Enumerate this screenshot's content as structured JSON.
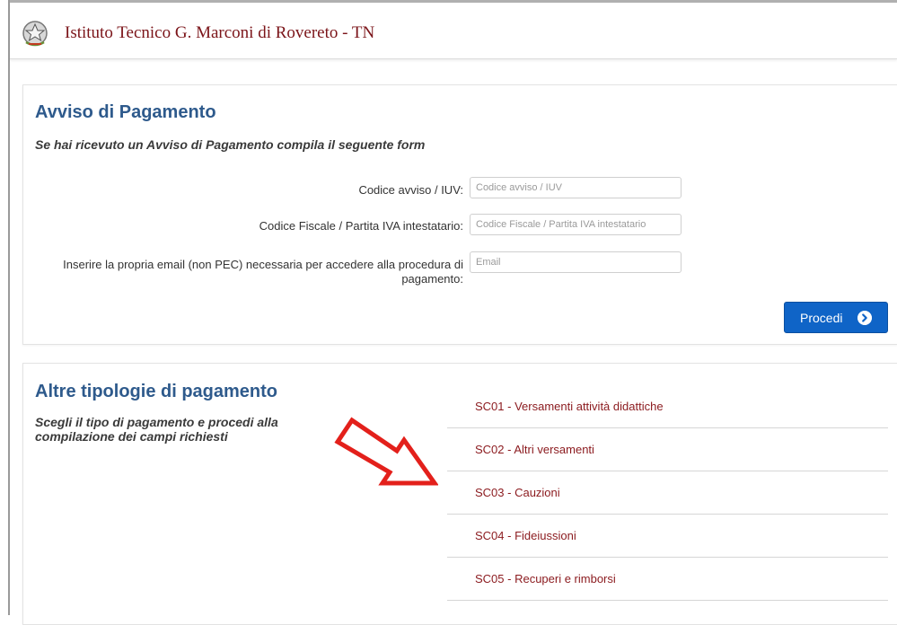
{
  "header": {
    "site_title": "Istituto Tecnico G. Marconi di Rovereto - TN",
    "emblem_icon": "italian-republic-emblem-icon"
  },
  "avviso": {
    "title": "Avviso di Pagamento",
    "subtitle": "Se hai ricevuto un Avviso di Pagamento compila il seguente form",
    "fields": [
      {
        "label": "Codice avviso / IUV:",
        "placeholder": "Codice avviso / IUV",
        "value": ""
      },
      {
        "label": "Codice Fiscale / Partita IVA intestatario:",
        "placeholder": "Codice Fiscale / Partita IVA intestatario",
        "value": ""
      },
      {
        "label": "Inserire la propria email (non PEC) necessaria per accedere alla procedura di pagamento:",
        "placeholder": "Email",
        "value": ""
      }
    ],
    "submit_label": "Procedi",
    "submit_icon": "arrow-right-circle-icon"
  },
  "altre": {
    "title": "Altre tipologie di pagamento",
    "subtitle": "Scegli il tipo di pagamento e procedi alla compilazione dei campi richiesti",
    "items": [
      {
        "label": "SC01 - Versamenti attività didattiche"
      },
      {
        "label": "SC02 - Altri versamenti"
      },
      {
        "label": "SC03 - Cauzioni"
      },
      {
        "label": "SC04 - Fideiussioni"
      },
      {
        "label": "SC05 - Recuperi e rimborsi"
      }
    ]
  },
  "annotation": {
    "arrow_icon": "red-outline-arrow-icon",
    "arrow_color": "#e3201b"
  },
  "colors": {
    "title_blue": "#2e5a8c",
    "link_red": "#8b1a1e",
    "button_blue": "#0f64c7"
  }
}
